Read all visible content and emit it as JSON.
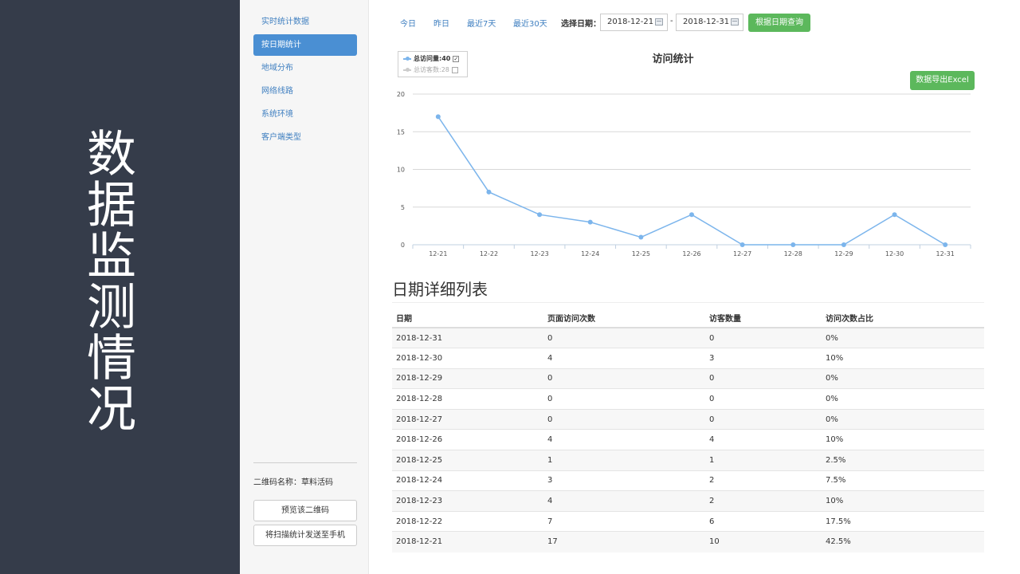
{
  "slide": {
    "title": "数据监测情况"
  },
  "sidebar": {
    "items": [
      {
        "label": "实时统计数据",
        "active": false
      },
      {
        "label": "按日期统计",
        "active": true
      },
      {
        "label": "地域分布",
        "active": false
      },
      {
        "label": "网络线路",
        "active": false
      },
      {
        "label": "系统环境",
        "active": false
      },
      {
        "label": "客户端类型",
        "active": false
      }
    ],
    "qr_label": "二维码名称：草料活码",
    "preview_button": "预览该二维码",
    "send_button": "将扫描统计发送至手机"
  },
  "toolbar": {
    "today": "今日",
    "yesterday": "昨日",
    "last7": "最近7天",
    "last30": "最近30天",
    "select_date_label": "选择日期：",
    "start_date": "2018-12-21",
    "end_date": "2018-12-31",
    "separator": "-",
    "query_button": "根据日期查询"
  },
  "export_button": "数据导出Excel",
  "legend": {
    "visits_label": "总访问量:40",
    "visitors_label": "总访客数:28"
  },
  "colors": {
    "accent": "#4a8fd3",
    "series": "#7cb5ec",
    "green": "#5cb85c",
    "dark": "#353c4a"
  },
  "chart_data": {
    "type": "line",
    "title": "访问统计",
    "categories": [
      "12-21",
      "12-22",
      "12-23",
      "12-24",
      "12-25",
      "12-26",
      "12-27",
      "12-28",
      "12-29",
      "12-30",
      "12-31"
    ],
    "series": [
      {
        "name": "总访问量:40",
        "values": [
          17,
          7,
          4,
          3,
          1,
          4,
          0,
          0,
          0,
          4,
          0
        ]
      }
    ],
    "ylim": [
      0,
      20
    ],
    "yticks": [
      0,
      5,
      10,
      15,
      20
    ],
    "grid": true,
    "legend_position": "top-left"
  },
  "list": {
    "title": "日期详细列表",
    "columns": [
      "日期",
      "页面访问次数",
      "访客数量",
      "访问次数占比"
    ],
    "rows": [
      [
        "2018-12-31",
        "0",
        "0",
        "0%"
      ],
      [
        "2018-12-30",
        "4",
        "3",
        "10%"
      ],
      [
        "2018-12-29",
        "0",
        "0",
        "0%"
      ],
      [
        "2018-12-28",
        "0",
        "0",
        "0%"
      ],
      [
        "2018-12-27",
        "0",
        "0",
        "0%"
      ],
      [
        "2018-12-26",
        "4",
        "4",
        "10%"
      ],
      [
        "2018-12-25",
        "1",
        "1",
        "2.5%"
      ],
      [
        "2018-12-24",
        "3",
        "2",
        "7.5%"
      ],
      [
        "2018-12-23",
        "4",
        "2",
        "10%"
      ],
      [
        "2018-12-22",
        "7",
        "6",
        "17.5%"
      ],
      [
        "2018-12-21",
        "17",
        "10",
        "42.5%"
      ]
    ]
  }
}
